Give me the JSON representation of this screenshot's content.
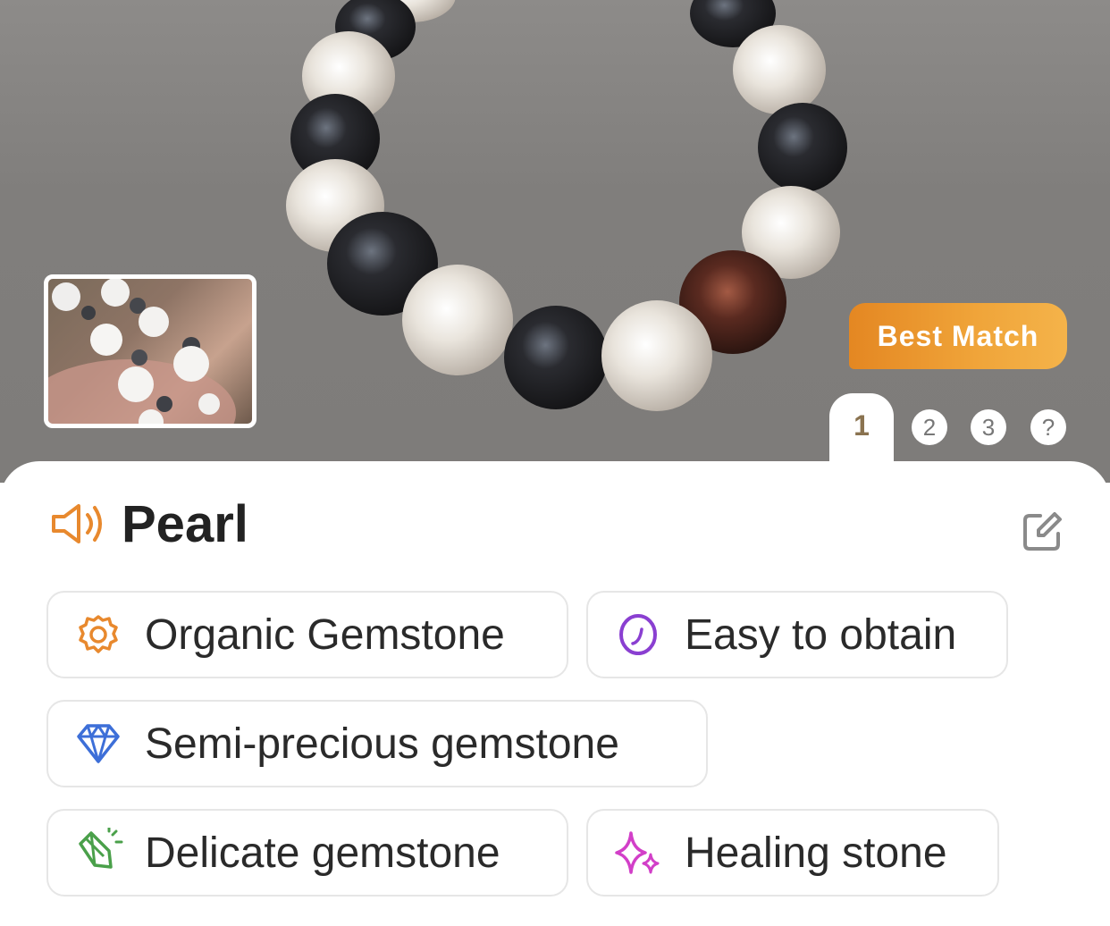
{
  "hero": {
    "badge_label": "Best Match",
    "pager": {
      "active": "1",
      "pages": [
        "2",
        "3",
        "?"
      ]
    }
  },
  "result": {
    "title": "Pearl",
    "speaker_icon": "speaker-icon",
    "edit_icon": "edit-icon"
  },
  "tags": [
    {
      "label": "Organic Gemstone",
      "icon": "shell-icon",
      "color": "#e8892e"
    },
    {
      "label": "Easy to obtain",
      "icon": "egg-icon",
      "color": "#8a3fd1"
    },
    {
      "label": "Semi-precious gemstone",
      "icon": "diamond-icon",
      "color": "#3d6fd8"
    },
    {
      "label": "Delicate gemstone",
      "icon": "crystal-icon",
      "color": "#4aa04a"
    },
    {
      "label": "Healing stone",
      "icon": "sparkle-icon",
      "color": "#d23fc8"
    }
  ]
}
